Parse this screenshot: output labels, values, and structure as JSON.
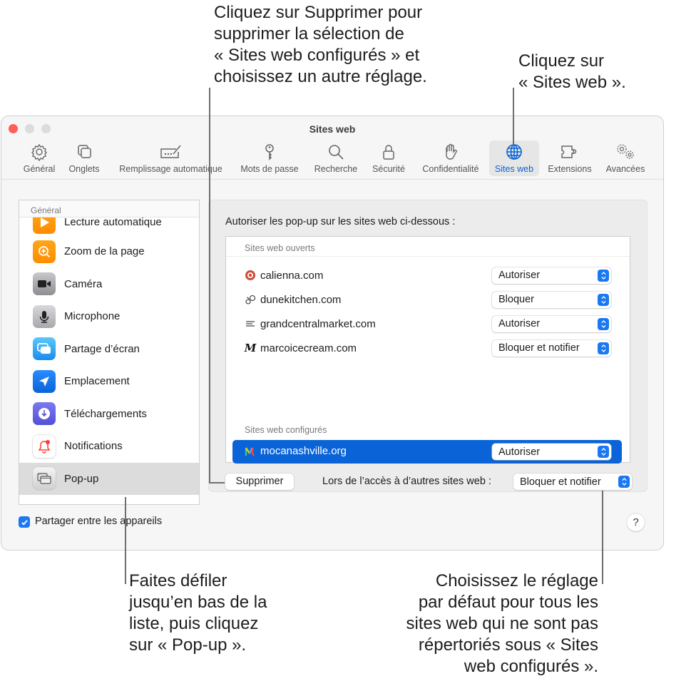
{
  "callouts": {
    "top_left": "Cliquez sur Supprimer pour\nsupprimer la sélection de\n« Sites web configurés » et\nchoisissez un autre réglage.",
    "top_right": "Cliquez sur\n« Sites web ».",
    "bottom_left": "Faites défiler\njusqu’en bas de la\nliste, puis cliquez\nsur « Pop-up ».",
    "bottom_right": "Choisissez le réglage\npar défaut pour tous les\nsites web qui ne sont pas\nrépertoriés sous « Sites\nweb configurés »."
  },
  "window": {
    "title": "Sites web"
  },
  "toolbar": {
    "items": [
      {
        "label": "Général",
        "icon": "gear-icon"
      },
      {
        "label": "Onglets",
        "icon": "tabs-icon"
      },
      {
        "label": "Remplissage automatique",
        "icon": "autofill-icon"
      },
      {
        "label": "Mots de passe",
        "icon": "key-icon"
      },
      {
        "label": "Recherche",
        "icon": "magnifier-icon"
      },
      {
        "label": "Sécurité",
        "icon": "lock-icon"
      },
      {
        "label": "Confidentialité",
        "icon": "hand-icon"
      },
      {
        "label": "Sites web",
        "icon": "globe-icon",
        "active": true
      },
      {
        "label": "Extensions",
        "icon": "puzzle-icon"
      },
      {
        "label": "Avancées",
        "icon": "gears-icon"
      }
    ],
    "accent_color": "#0a63d6"
  },
  "sidebar": {
    "header": "Général",
    "items": [
      {
        "label": "Lecture automatique",
        "icon": "play-icon",
        "color": "#ff9500"
      },
      {
        "label": "Zoom de la page",
        "icon": "zoom-icon",
        "color": "#ff9500"
      },
      {
        "label": "Caméra",
        "icon": "camera-icon",
        "color": "#8e8e93"
      },
      {
        "label": "Microphone",
        "icon": "microphone-icon",
        "color": "#b0b0b5"
      },
      {
        "label": "Partage d’écran",
        "icon": "screen-share-icon",
        "color": "#2aa3f5"
      },
      {
        "label": "Emplacement",
        "icon": "location-icon",
        "color": "#1a78f2"
      },
      {
        "label": "Téléchargements",
        "icon": "download-icon",
        "color": "#5d5ce6"
      },
      {
        "label": "Notifications",
        "icon": "bell-icon",
        "color": "#ffffff"
      },
      {
        "label": "Pop-up",
        "icon": "popup-window-icon",
        "color": "#d8d8d8",
        "selected": true
      }
    ]
  },
  "panel": {
    "title": "Autoriser les pop-up sur les sites web ci-dessous :",
    "open_header": "Sites web ouverts",
    "open_sites": [
      {
        "name": "calienna.com",
        "value": "Autoriser",
        "favicon": "calienna-favicon"
      },
      {
        "name": "dunekitchen.com",
        "value": "Bloquer",
        "favicon": "dunekitchen-favicon"
      },
      {
        "name": "grandcentralmarket.com",
        "value": "Autoriser",
        "favicon": "grandcentral-favicon"
      },
      {
        "name": "marcoicecream.com",
        "value": "Bloquer et notifier",
        "favicon": "marco-favicon"
      }
    ],
    "configured_header": "Sites web configurés",
    "configured_sites": [
      {
        "name": "mocanashville.org",
        "value": "Autoriser",
        "favicon": "moca-favicon",
        "selected": true
      }
    ],
    "remove_button": "Supprimer",
    "other_sites_label": "Lors de l’accès à d’autres sites web :",
    "other_sites_value": "Bloquer et notifier"
  },
  "footer": {
    "share_label": "Partager entre les appareils",
    "share_checked": true,
    "help_label": "?"
  }
}
